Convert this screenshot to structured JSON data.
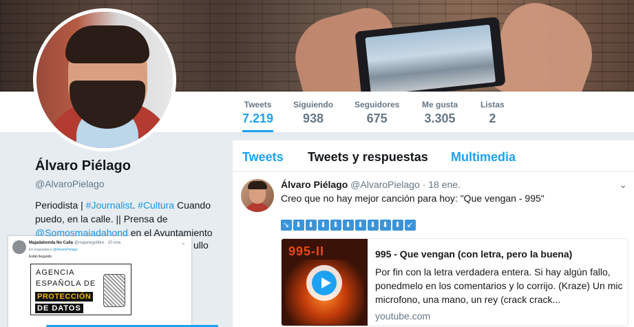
{
  "profile": {
    "name": "Álvaro Piélago",
    "handle": "@AlvaroPielago",
    "bio_parts": [
      "Periodista | ",
      "#Journalist",
      ". ",
      "#Cultura",
      " Cuando puedo, en la calle. || Prensa de ",
      "@Somosmajadahond",
      " en el Ayuntamiento"
    ],
    "bio_tail": "ullo"
  },
  "nav": [
    {
      "label": "Tweets",
      "value": "7.219"
    },
    {
      "label": "Siguiendo",
      "value": "938"
    },
    {
      "label": "Seguidores",
      "value": "675"
    },
    {
      "label": "Me gusta",
      "value": "3.305"
    },
    {
      "label": "Listas",
      "value": "2"
    }
  ],
  "timeline_tabs": [
    "Tweets",
    "Tweets y respuestas",
    "Multimedia"
  ],
  "tweet": {
    "name": "Álvaro Piélago",
    "handle": "@AlvaroPielago",
    "date": "· 18 ene.",
    "text": "Creo que no hay mejor canción para hoy: \"Que vengan - 995\"",
    "arrows": [
      "↘",
      "⬇",
      "⬇",
      "⬇",
      "⬇",
      "⬇",
      "⬇",
      "⬇",
      "⬇",
      "⬇",
      "↙"
    ],
    "caret_icon": "chevron-down-icon"
  },
  "card": {
    "thumb_text": "995-II",
    "title": "995 - Que vengan (con letra, pero la buena)",
    "description": "Por fin con la letra verdadera entera. Si hay algún fallo, ponedmelo en los comentarios y lo corrijo. (Kraze) Un mic microfono, una mano, un rey (crack crack...",
    "domain": "youtube.com"
  },
  "overlay_tweet": {
    "name": "Majadahonda No Calla",
    "handle": "@majanegolibre · 20 ene.",
    "reply_prefix": "En respuesta a ",
    "reply_to": "@AlvaroPielago",
    "text": "Están llegando",
    "image_lines": [
      "AGENCIA",
      "ESPAÑOLA DE",
      "PROTECCIÓN",
      "DE DATOS"
    ]
  },
  "colors": {
    "accent": "#1da1f2",
    "link": "#1b95e0",
    "muted": "#657786",
    "background": "#e6ecf0"
  }
}
